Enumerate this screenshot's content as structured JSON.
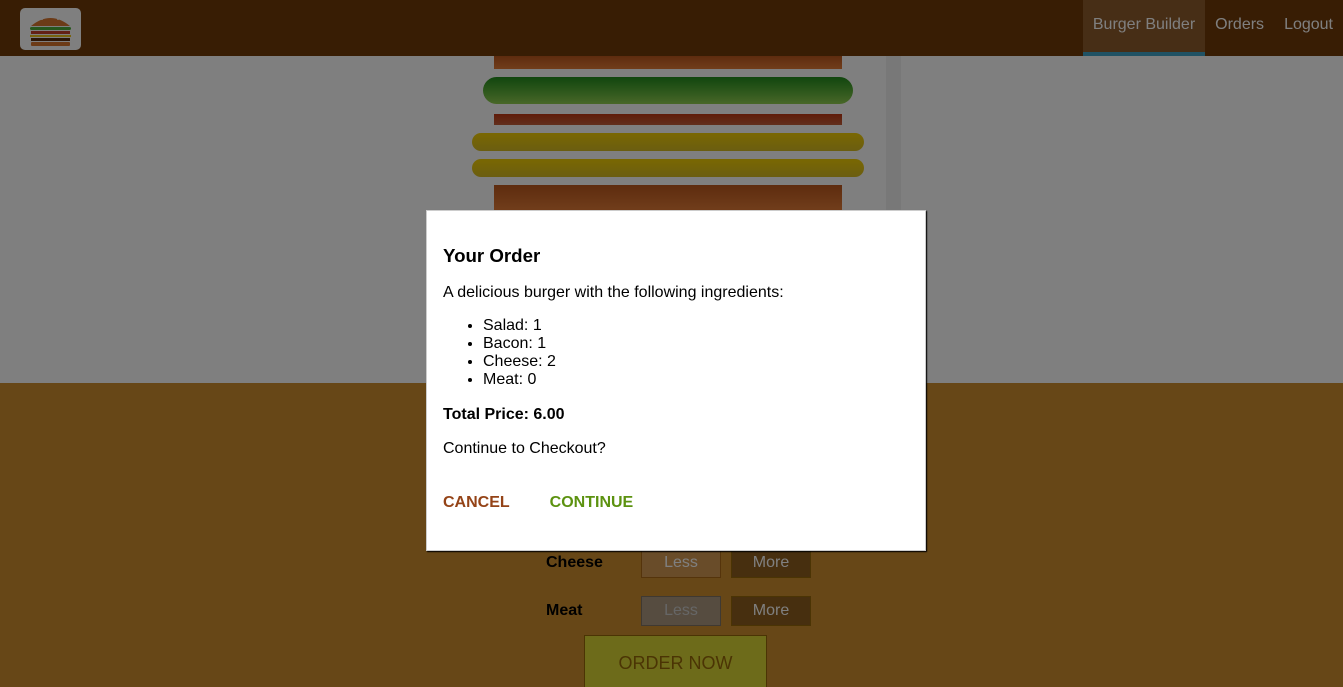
{
  "toolbar": {
    "logo_icon": "burger-logo-icon",
    "nav": [
      {
        "label": "Burger Builder",
        "active": true
      },
      {
        "label": "Orders",
        "active": false
      },
      {
        "label": "Logout",
        "active": false
      }
    ]
  },
  "controls": {
    "rows": [
      {
        "label": "Cheese",
        "less": "Less",
        "more": "More",
        "less_disabled": false
      },
      {
        "label": "Meat",
        "less": "Less",
        "more": "More",
        "less_disabled": true
      }
    ],
    "order_button": "ORDER NOW"
  },
  "modal": {
    "title": "Your Order",
    "intro": "A delicious burger with the following ingredients:",
    "ingredients": [
      {
        "name": "Salad",
        "count": 1
      },
      {
        "name": "Bacon",
        "count": 1
      },
      {
        "name": "Cheese",
        "count": 2
      },
      {
        "name": "Meat",
        "count": 0
      }
    ],
    "total_price_label": "Total Price: 6.00",
    "checkout_question": "Continue to Checkout?",
    "cancel_label": "CANCEL",
    "continue_label": "CONTINUE"
  },
  "colors": {
    "toolbar": "#703b09",
    "nav_active_border": "#40a4c8",
    "controls_bg": "#cf8f2e",
    "cancel": "#944317",
    "continue": "#5c9210"
  }
}
